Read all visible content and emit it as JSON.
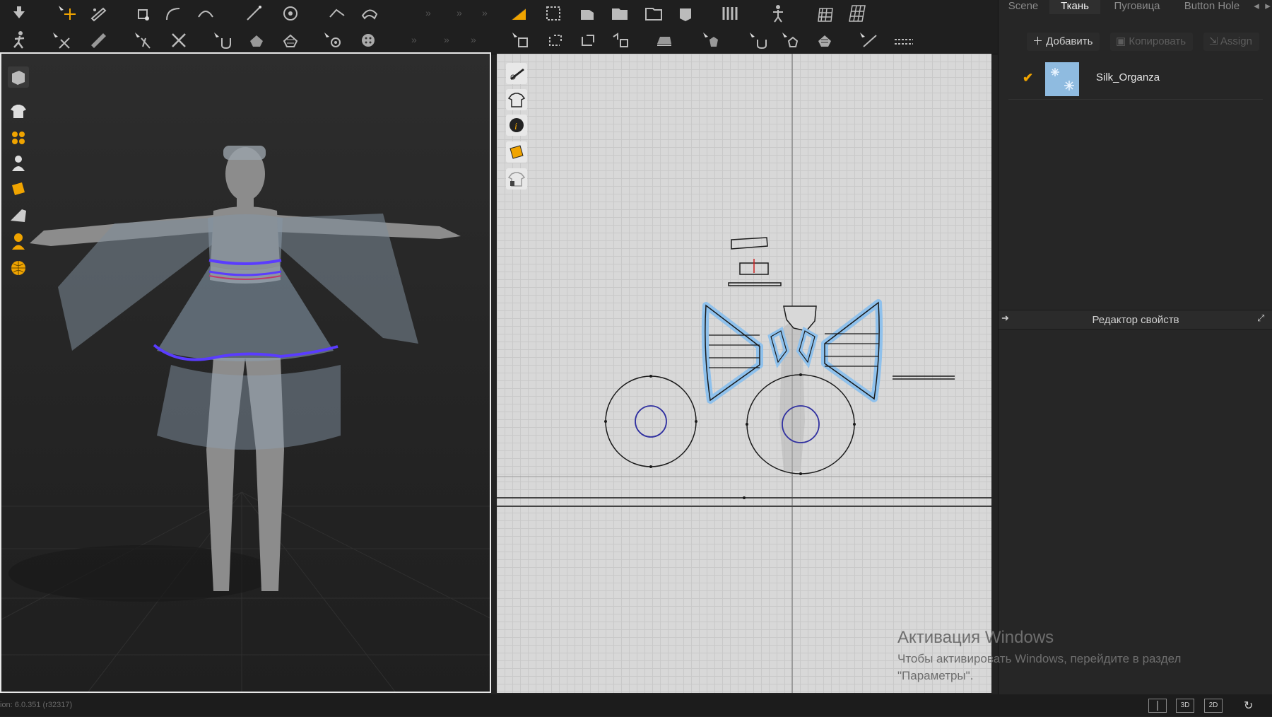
{
  "tabs": [
    {
      "label": "Scene",
      "active": false
    },
    {
      "label": "Ткань",
      "active": true
    },
    {
      "label": "Пуговица",
      "active": false
    },
    {
      "label": "Button Hole",
      "active": false
    }
  ],
  "fabric_panel": {
    "add_label": "Добавить",
    "copy_label": "Копировать",
    "assign_label": "Assign",
    "fabric_name": "Silk_Organza",
    "fabric_checked": true
  },
  "property_editor": {
    "title": "Редактор свойств"
  },
  "watermark": {
    "line1": "Активация Windows",
    "line2": "Чтобы активировать Windows, перейдите в раздел",
    "line3": "\"Параметры\"."
  },
  "status": {
    "version": "ion: 6.0.351 (r32317)"
  },
  "view_buttons": [
    "3D",
    "2D"
  ],
  "colors": {
    "accent": "#f0a400",
    "selection_blue": "#5a9bd8",
    "seam_purple": "#5a3cff",
    "pattern_line": "#1a1a1a"
  },
  "toolbar_icons_row1": [
    "arrow-down-icon",
    "move-pointer-icon",
    "edit-pattern-icon",
    "edit-point-icon",
    "edit-curve-icon",
    "curvature-icon",
    "segment-icon",
    "fold-icon",
    "trace-icon",
    "pattern-arrange-icon",
    "polygon-icon",
    "rectangle-icon",
    "ellipse-icon",
    "internal-polygon-icon",
    "dart-icon",
    "avatar-icon",
    "grid-icon",
    "texture-icon"
  ],
  "toolbar_icons_row2": [
    "avatar-pose-icon",
    "select-mesh-icon",
    "fold-arrange-icon",
    "pin-icon",
    "cut-icon",
    "simulation-icon",
    "tack-icon",
    "tape-icon",
    "button-icon",
    "buttonhole-icon",
    "segment-sewing-icon",
    "free-sewing-icon",
    "sewing-check-icon",
    "iron-icon",
    "tack-2d-icon",
    "trim-icon",
    "zipper-icon",
    "measure-icon",
    "ruler-icon"
  ]
}
